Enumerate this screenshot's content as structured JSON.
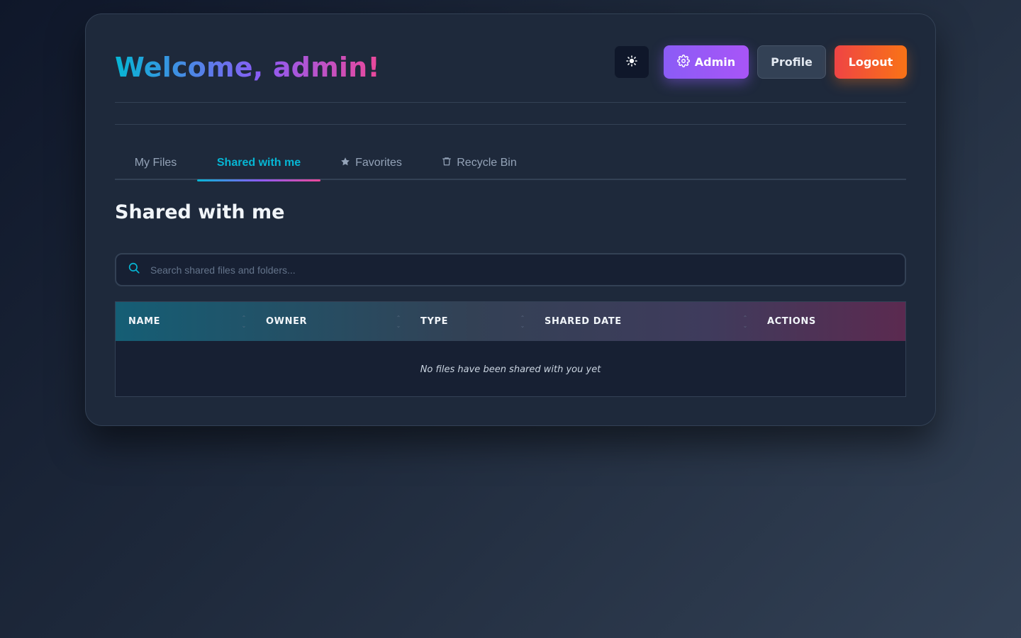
{
  "header": {
    "welcome_text": "Welcome, admin!",
    "theme_icon": "sun-icon",
    "admin_label": "Admin",
    "admin_icon": "gear-icon",
    "profile_label": "Profile",
    "logout_label": "Logout"
  },
  "tabs": [
    {
      "label": "My Files",
      "icon": null,
      "active": false
    },
    {
      "label": "Shared with me",
      "icon": null,
      "active": true
    },
    {
      "label": "Favorites",
      "icon": "star-icon",
      "active": false
    },
    {
      "label": "Recycle Bin",
      "icon": "trash-icon",
      "active": false
    }
  ],
  "main": {
    "title": "Shared with me",
    "search": {
      "placeholder": "Search shared files and folders...",
      "value": ""
    },
    "table": {
      "columns": [
        "NAME",
        "OWNER",
        "TYPE",
        "SHARED DATE",
        "ACTIONS"
      ],
      "rows": [],
      "empty_message": "No files have been shared with you yet"
    }
  },
  "colors": {
    "accent_cyan": "#06b6d4",
    "accent_purple": "#8b5cf6",
    "accent_pink": "#ec4899",
    "logout_orange": "#f97316",
    "background": "#1e293b"
  }
}
